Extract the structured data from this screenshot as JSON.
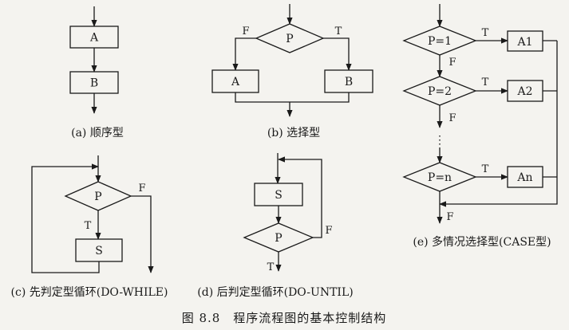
{
  "diagrams": {
    "a": {
      "box1": "A",
      "box2": "B",
      "caption": "(a) 顺序型"
    },
    "b": {
      "decision": "P",
      "false_label": "F",
      "true_label": "T",
      "box_left": "A",
      "box_right": "B",
      "caption": "(b) 选择型"
    },
    "c": {
      "decision": "P",
      "false_label": "F",
      "true_label": "T",
      "box": "S",
      "caption": "(c) 先判定型循环(DO-WHILE)"
    },
    "d": {
      "box": "S",
      "decision": "P",
      "false_label": "F",
      "true_label": "T",
      "caption": "(d) 后判定型循环(DO-UNTIL)"
    },
    "e": {
      "cases": [
        {
          "decision": "P=1",
          "true_label": "T",
          "box": "A1",
          "false_label": "F"
        },
        {
          "decision": "P=2",
          "true_label": "T",
          "box": "A2",
          "false_label": "F"
        },
        {
          "decision": "P=n",
          "true_label": "T",
          "box": "An",
          "false_label": "F"
        }
      ],
      "ellipsis": "⋮",
      "caption": "(e) 多情况选择型(CASE型)"
    }
  },
  "figure_title": "图 8.8　程序流程图的基本控制结构"
}
